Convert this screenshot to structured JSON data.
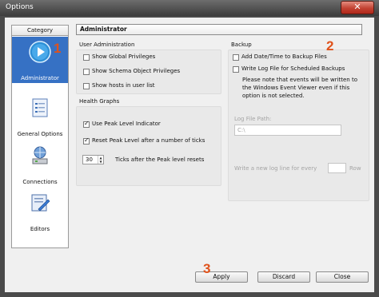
{
  "window": {
    "title": "Options"
  },
  "category": {
    "header": "Category",
    "items": [
      {
        "label": "Administrator",
        "icon": "play-icon",
        "selected": true
      },
      {
        "label": "General Options",
        "icon": "document-icon",
        "selected": false
      },
      {
        "label": "Connections",
        "icon": "network-icon",
        "selected": false
      },
      {
        "label": "Editors",
        "icon": "editor-icon",
        "selected": false
      }
    ]
  },
  "page_title": "Administrator",
  "user_admin": {
    "label": "User Administration",
    "options": [
      {
        "label": "Show Global Privileges",
        "checked": false
      },
      {
        "label": "Show Schema Object Privileges",
        "checked": false
      },
      {
        "label": "Show hosts in user list",
        "checked": false
      }
    ]
  },
  "health": {
    "label": "Health Graphs",
    "options": [
      {
        "label": "Use Peak Level Indicator",
        "checked": true
      },
      {
        "label": "Reset Peak Level after a number of ticks",
        "checked": true
      }
    ],
    "ticks_value": "30",
    "ticks_label": "Ticks after the Peak level resets"
  },
  "backup": {
    "label": "Backup",
    "options": [
      {
        "label": "Add Date/Time to Backup Files",
        "checked": false
      },
      {
        "label": "Write Log File for Scheduled Backups",
        "checked": false
      }
    ],
    "note_lines": [
      "Please note that events will be written to",
      "the Windows Event Viewer even if this",
      "option is not selected."
    ],
    "log_path_label": "Log File Path:",
    "log_path_value": "C:\\",
    "newline_label": "Write a new  log line for every",
    "newline_value": "",
    "row_label": "Row"
  },
  "buttons": {
    "apply": "Apply",
    "discard": "Discard",
    "close": "Close"
  },
  "annotations": [
    "1",
    "2",
    "3"
  ],
  "colors": {
    "selection": "#3671c4",
    "annotation": "#e0521b",
    "close_button": "#c34333"
  }
}
